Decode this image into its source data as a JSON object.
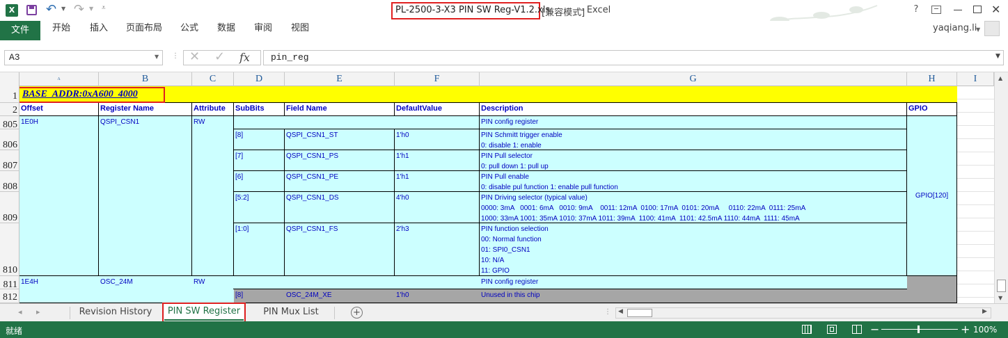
{
  "window": {
    "title_file": "PL-2500-3-X3 PIN SW Reg-V1.2.xls",
    "title_mode": "[兼容模式]",
    "title_app": " - Excel",
    "help": "?",
    "user": "yaqiang.li"
  },
  "ribbon": {
    "file": "文件",
    "tabs": [
      "开始",
      "插入",
      "页面布局",
      "公式",
      "数据",
      "审阅",
      "视图"
    ]
  },
  "formula_bar": {
    "name_box": "A3",
    "fx": "fx",
    "value": "pin_reg"
  },
  "grid": {
    "columns": [
      "A",
      "B",
      "C",
      "D",
      "E",
      "F",
      "G",
      "H",
      "I"
    ],
    "row_numbers": [
      "1",
      "2",
      "805",
      "806",
      "807",
      "808",
      "809",
      "810",
      "811",
      "812"
    ],
    "base_addr": "BASE_ADDR:0xA600_4000",
    "headers": [
      "Offset",
      "Register Name",
      "Attribute",
      "SubBits",
      "Field Name",
      "DefaultValue",
      "Description",
      "GPIO"
    ],
    "reg1": {
      "offset": "1E0H",
      "name": "QSPI_CSN1",
      "attr": "RW",
      "desc": "PIN config register",
      "gpio": "GPIO[120]",
      "fields": [
        {
          "bits": "[8]",
          "name": "QSPI_CSN1_ST",
          "default": "1'h0",
          "desc": [
            "PIN Schmitt trigger enable",
            "0: disable 1: enable"
          ]
        },
        {
          "bits": "[7]",
          "name": "QSPI_CSN1_PS",
          "default": "1'h1",
          "desc": [
            "PIN Pull selector",
            "0: pull down 1: pull up"
          ]
        },
        {
          "bits": "[6]",
          "name": "QSPI_CSN1_PE",
          "default": "1'h1",
          "desc": [
            "PIN Pull enable",
            "0: disable pul function 1: enable pull function"
          ]
        },
        {
          "bits": "[5:2]",
          "name": "QSPI_CSN1_DS",
          "default": "4'h0",
          "desc": [
            "PIN Driving selector (typical value)",
            "0000: 3mA   0001: 6mA   0010: 9mA    0011: 12mA  0100: 17mA  0101: 20mA     0110: 22mA  0111: 25mA",
            "1000: 33mA 1001: 35mA 1010: 37mA 1011: 39mA  1100: 41mA  1101: 42.5mA 1110: 44mA  1111: 45mA"
          ]
        },
        {
          "bits": "[1:0]",
          "name": "QSPI_CSN1_FS",
          "default": "2'h3",
          "desc": [
            "PIN function selection",
            "00: Normal function",
            "01: SPI0_CSN1",
            "10: N/A",
            "11: GPIO"
          ]
        }
      ]
    },
    "reg2": {
      "offset": "1E4H",
      "name": "OSC_24M",
      "attr": "RW",
      "desc": "PIN config register",
      "fields": [
        {
          "bits": "[8]",
          "name": "OSC_24M_XE",
          "default": "1'h0",
          "desc": [
            "Unused in this chip"
          ]
        }
      ]
    }
  },
  "sheet_tabs": {
    "tabs": [
      "Revision History",
      "PIN SW Register",
      "PIN Mux List"
    ],
    "active": "PIN SW Register"
  },
  "status": {
    "ready": "就绪",
    "zoom": "100%"
  },
  "colors": {
    "excel_green": "#217346",
    "cell_cyan": "#ccffff",
    "cell_grey": "#a6a6a6",
    "header_yellow": "#ffff00",
    "text_blue": "#0000c0",
    "highlight_red": "#e02020"
  }
}
